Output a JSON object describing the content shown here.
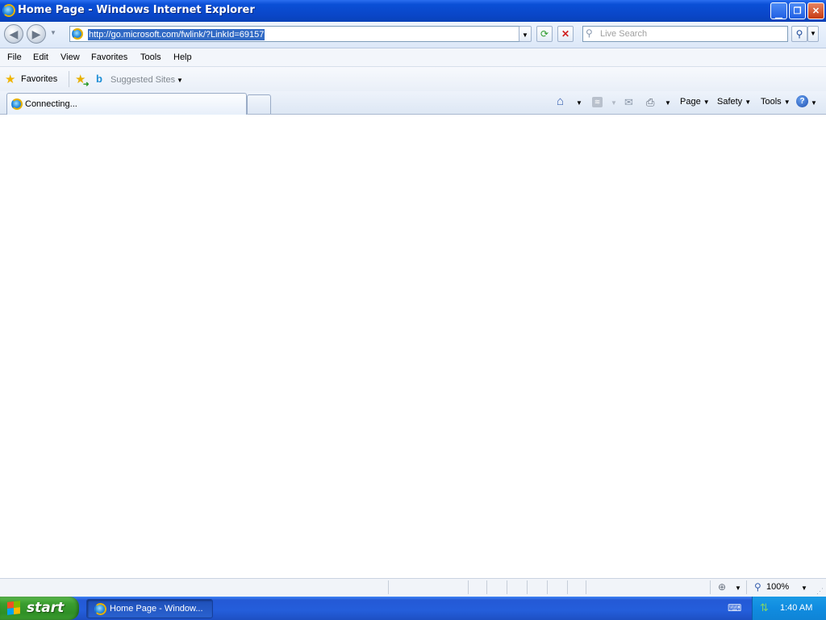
{
  "window": {
    "title": "Home Page - Windows Internet Explorer",
    "controls": [
      "minimize",
      "restore",
      "close"
    ]
  },
  "address_bar": {
    "url": "http://go.microsoft.com/fwlink/?LinkId=69157",
    "search_placeholder": "Live Search"
  },
  "menu": {
    "items": [
      "File",
      "Edit",
      "View",
      "Favorites",
      "Tools",
      "Help"
    ]
  },
  "favorites_bar": {
    "favorites_label": "Favorites",
    "suggested_sites_label": "Suggested Sites"
  },
  "tabs": {
    "active_label": "Connecting..."
  },
  "command_bar": {
    "page_label": "Page",
    "safety_label": "Safety",
    "tools_label": "Tools"
  },
  "status_bar": {
    "zoom": "100%"
  },
  "taskbar": {
    "start_label": "start",
    "task_label": "Home Page - Window...",
    "clock": "1:40 AM"
  },
  "icons": [
    "ie-logo-icon",
    "back-icon",
    "forward-icon",
    "refresh-icon",
    "stop-icon",
    "search-icon",
    "favorites-star-icon",
    "add-favorite-icon",
    "bing-icon",
    "home-icon",
    "feeds-icon",
    "mail-icon",
    "print-icon",
    "help-icon",
    "zoom-icon",
    "windows-logo-icon"
  ],
  "colors": {
    "title_bar": "#0a4fd6",
    "url_highlight": "#316ac5",
    "start_button": "#3a9d2f",
    "taskbar": "#245edb"
  }
}
